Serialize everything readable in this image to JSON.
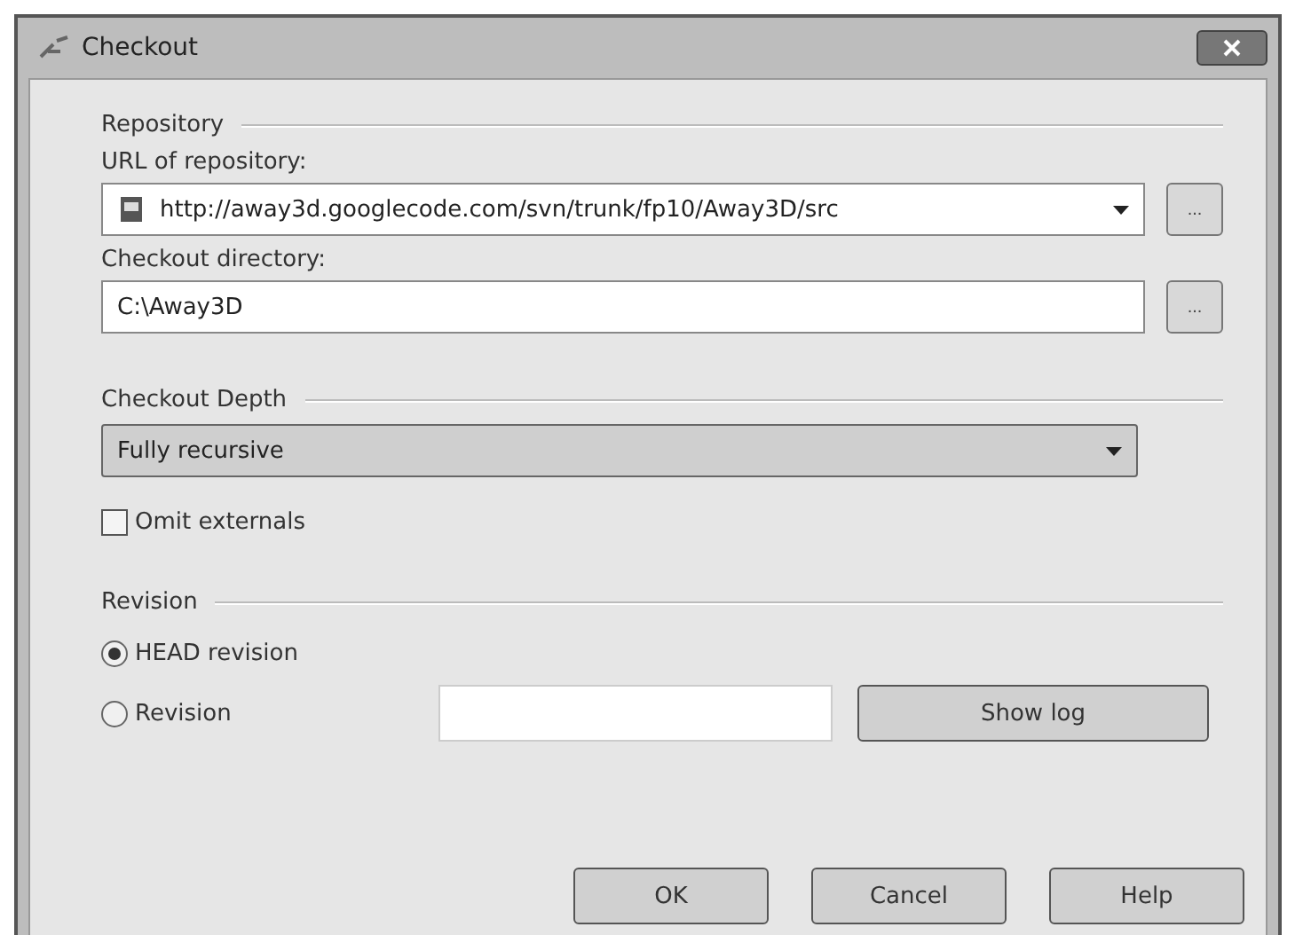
{
  "window": {
    "title": "Checkout"
  },
  "repository": {
    "heading": "Repository",
    "url_label": "URL of repository:",
    "url": "http://away3d.googlecode.com/svn/trunk/fp10/Away3D/src",
    "url_browse": "...",
    "directory_label": "Checkout directory:",
    "directory": "C:\\Away3D",
    "directory_browse": "..."
  },
  "depth": {
    "heading": "Checkout Depth",
    "value": "Fully recursive"
  },
  "omit_externals": {
    "label": "Omit externals",
    "checked": false
  },
  "revision": {
    "heading": "Revision",
    "options": [
      {
        "label": "HEAD revision",
        "selected": true
      },
      {
        "label": "Revision",
        "selected": false
      }
    ],
    "show_log": "Show log"
  },
  "buttons": [
    "OK",
    "Cancel",
    "Help"
  ]
}
